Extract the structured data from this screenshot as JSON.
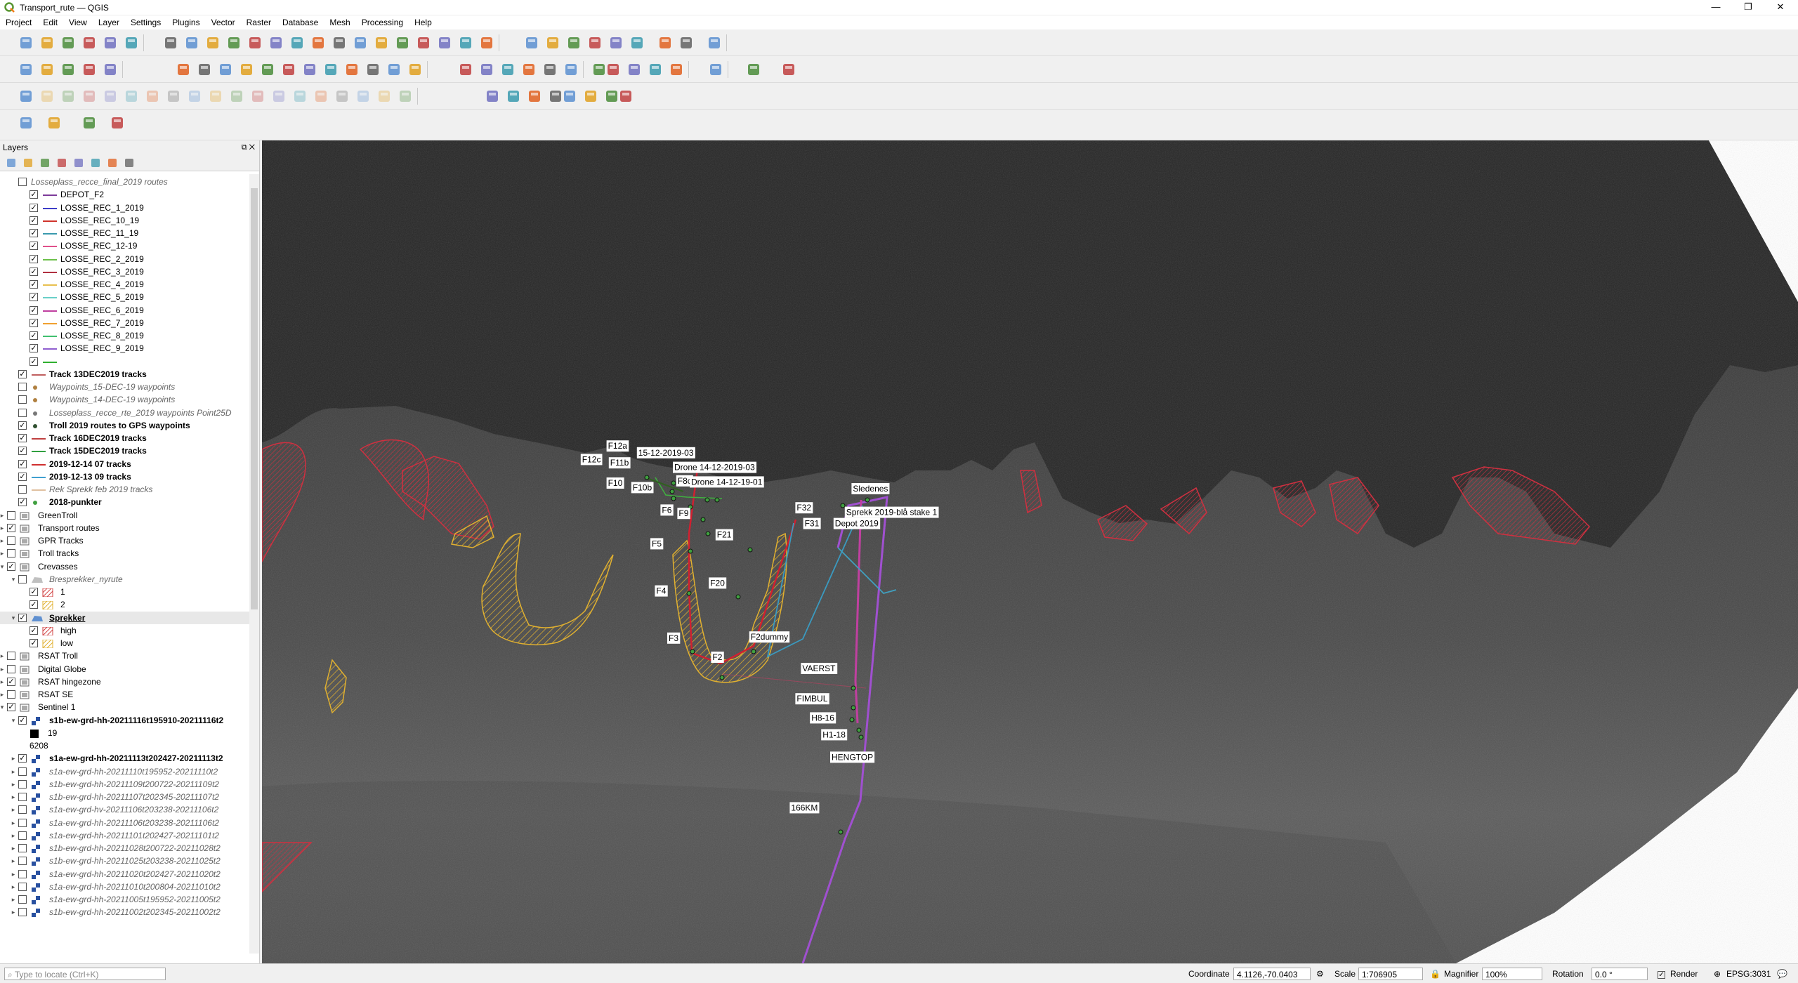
{
  "window": {
    "title": "Transport_rute — QGIS",
    "minimize": "—",
    "maximize": "❐",
    "close": "✕"
  },
  "menu": [
    "Project",
    "Edit",
    "View",
    "Layer",
    "Settings",
    "Plugins",
    "Vector",
    "Raster",
    "Database",
    "Mesh",
    "Processing",
    "Help"
  ],
  "layers_panel": {
    "title": "Layers",
    "items": [
      {
        "label": "Losseplass_recce_final_2019 routes",
        "style": "ital",
        "indent": 2,
        "check": false
      },
      {
        "label": "DEPOT_F2",
        "indent": 3,
        "check": true,
        "color": "#7d3b9a"
      },
      {
        "label": "LOSSE_REC_1_2019",
        "indent": 3,
        "check": true,
        "color": "#3d3dc8"
      },
      {
        "label": "LOSSE_REC_10_19",
        "indent": 3,
        "check": true,
        "color": "#d0342c"
      },
      {
        "label": "LOSSE_REC_11_19",
        "indent": 3,
        "check": true,
        "color": "#3a9aae"
      },
      {
        "label": "LOSSE_REC_12-19",
        "indent": 3,
        "check": true,
        "color": "#e0508a"
      },
      {
        "label": "LOSSE_REC_2_2019",
        "indent": 3,
        "check": true,
        "color": "#6cc04a"
      },
      {
        "label": "LOSSE_REC_3_2019",
        "indent": 3,
        "check": true,
        "color": "#b03040"
      },
      {
        "label": "LOSSE_REC_4_2019",
        "indent": 3,
        "check": true,
        "color": "#e8c050"
      },
      {
        "label": "LOSSE_REC_5_2019",
        "indent": 3,
        "check": true,
        "color": "#6ad0c8"
      },
      {
        "label": "LOSSE_REC_6_2019",
        "indent": 3,
        "check": true,
        "color": "#c040a0"
      },
      {
        "label": "LOSSE_REC_7_2019",
        "indent": 3,
        "check": true,
        "color": "#f0a030"
      },
      {
        "label": "LOSSE_REC_8_2019",
        "indent": 3,
        "check": true,
        "color": "#40c070"
      },
      {
        "label": "LOSSE_REC_9_2019",
        "indent": 3,
        "check": true,
        "color": "#9060d0"
      },
      {
        "label": "",
        "indent": 3,
        "check": true,
        "color": "#30b030"
      },
      {
        "label": "Track 13DEC2019 tracks",
        "style": "bold",
        "indent": 2,
        "check": true,
        "color": "#c06060"
      },
      {
        "label": "Waypoints_15-DEC-19 waypoints",
        "style": "ital",
        "indent": 2,
        "check": false,
        "dot": "#b08040"
      },
      {
        "label": "Waypoints_14-DEC-19 waypoints",
        "style": "ital",
        "indent": 2,
        "check": false,
        "dot": "#b08040"
      },
      {
        "label": "Losseplass_recce_rte_2019 waypoints Point25D",
        "style": "ital",
        "indent": 2,
        "check": false,
        "dot": "#777777"
      },
      {
        "label": "Troll 2019 routes to GPS waypoints",
        "style": "bold",
        "indent": 2,
        "check": true,
        "dot": "#305030"
      },
      {
        "label": "Track 16DEC2019 tracks",
        "style": "bold",
        "indent": 2,
        "check": true,
        "color": "#c04040"
      },
      {
        "label": "Track 15DEC2019 tracks",
        "style": "bold",
        "indent": 2,
        "check": true,
        "color": "#30a040"
      },
      {
        "label": "2019-12-14 07 tracks",
        "style": "bold",
        "indent": 2,
        "check": true,
        "color": "#d03030"
      },
      {
        "label": "2019-12-13 09 tracks",
        "style": "bold",
        "indent": 2,
        "check": true,
        "color": "#40a0d0"
      },
      {
        "label": "Rek Sprekk feb 2019 tracks",
        "style": "ital",
        "indent": 2,
        "check": false,
        "color": "#e0c0a0"
      },
      {
        "label": "2018-punkter",
        "style": "bold",
        "indent": 2,
        "check": true,
        "dot": "#40a040"
      },
      {
        "label": "GreenTroll",
        "indent": 1,
        "check": false,
        "group": true,
        "exp": "▸"
      },
      {
        "label": "Transport routes",
        "indent": 1,
        "check": true,
        "group": true,
        "exp": "▸"
      },
      {
        "label": "GPR Tracks",
        "indent": 1,
        "check": false,
        "group": true,
        "exp": "▸"
      },
      {
        "label": "Troll tracks",
        "indent": 1,
        "check": false,
        "group": true,
        "exp": "▸"
      },
      {
        "label": "Crevasses",
        "indent": 1,
        "check": true,
        "group": true,
        "exp": "▾"
      },
      {
        "label": "Bresprekker_nyrute",
        "style": "ital",
        "indent": 2,
        "check": false,
        "exp": "▾",
        "poly": "#c0c0c0"
      },
      {
        "label": "1",
        "indent": 3,
        "check": true,
        "hatch": "#d04040"
      },
      {
        "label": "2",
        "indent": 3,
        "check": true,
        "hatch": "#e0b030"
      },
      {
        "label": "Sprekker",
        "style": "bold-u",
        "indent": 2,
        "check": true,
        "exp": "▾",
        "poly": "#6090d0",
        "selected": true
      },
      {
        "label": "high",
        "indent": 3,
        "check": true,
        "hatch": "#d04040"
      },
      {
        "label": "low",
        "indent": 3,
        "check": true,
        "hatch": "#e0b030"
      },
      {
        "label": "RSAT Troll",
        "indent": 1,
        "check": false,
        "group": true,
        "exp": "▸"
      },
      {
        "label": "Digital Globe",
        "indent": 1,
        "check": false,
        "group": true,
        "exp": "▸"
      },
      {
        "label": "RSAT hingezone",
        "indent": 1,
        "check": true,
        "group": true,
        "exp": "▸"
      },
      {
        "label": "RSAT SE",
        "indent": 1,
        "check": false,
        "group": true,
        "exp": "▸"
      },
      {
        "label": "Sentinel 1",
        "indent": 1,
        "check": true,
        "group": true,
        "exp": "▾"
      },
      {
        "label": "s1b-ew-grd-hh-20211116t195910-20211116t2",
        "style": "bold",
        "indent": 2,
        "check": true,
        "exp": "▾",
        "raster": true
      },
      {
        "label": "19",
        "indent": 3,
        "swatch": "#000000"
      },
      {
        "label": "6208",
        "indent": 3
      },
      {
        "label": "s1a-ew-grd-hh-20211113t202427-20211113t2",
        "style": "bold",
        "indent": 2,
        "check": true,
        "exp": "▸",
        "raster": true
      },
      {
        "label": "s1a-ew-grd-hh-20211110t195952-20211110t2",
        "style": "ital",
        "indent": 2,
        "check": false,
        "exp": "▸",
        "raster": true
      },
      {
        "label": "s1b-ew-grd-hh-20211109t200722-20211109t2",
        "style": "ital",
        "indent": 2,
        "check": false,
        "exp": "▸",
        "raster": true
      },
      {
        "label": "s1b-ew-grd-hh-20211107t202345-20211107t2",
        "style": "ital",
        "indent": 2,
        "check": false,
        "exp": "▸",
        "raster": true
      },
      {
        "label": "s1a-ew-grd-hv-20211106t203238-20211106t2",
        "style": "ital",
        "indent": 2,
        "check": false,
        "exp": "▸",
        "raster": true
      },
      {
        "label": "s1a-ew-grd-hh-20211106t203238-20211106t2",
        "style": "ital",
        "indent": 2,
        "check": false,
        "exp": "▸",
        "raster": true
      },
      {
        "label": "s1a-ew-grd-hh-20211101t202427-20211101t2",
        "style": "ital",
        "indent": 2,
        "check": false,
        "exp": "▸",
        "raster": true
      },
      {
        "label": "s1b-ew-grd-hh-20211028t200722-20211028t2",
        "style": "ital",
        "indent": 2,
        "check": false,
        "exp": "▸",
        "raster": true
      },
      {
        "label": "s1b-ew-grd-hh-20211025t203238-20211025t2",
        "style": "ital",
        "indent": 2,
        "check": false,
        "exp": "▸",
        "raster": true
      },
      {
        "label": "s1a-ew-grd-hh-20211020t202427-20211020t2",
        "style": "ital",
        "indent": 2,
        "check": false,
        "exp": "▸",
        "raster": true
      },
      {
        "label": "s1a-ew-grd-hh-20211010t200804-20211010t2",
        "style": "ital",
        "indent": 2,
        "check": false,
        "exp": "▸",
        "raster": true
      },
      {
        "label": "s1a-ew-grd-hh-20211005t195952-20211005t2",
        "style": "ital",
        "indent": 2,
        "check": false,
        "exp": "▸",
        "raster": true
      },
      {
        "label": "s1b-ew-grd-hh-20211002t202345-20211002t2",
        "style": "ital",
        "indent": 2,
        "check": false,
        "exp": "▸",
        "raster": true
      }
    ]
  },
  "map_labels": [
    "F12c",
    "F12a",
    "F11b",
    "15-12-2019-03",
    "Drone 14-12-2019-03",
    "F8c",
    "Drone 14-12-19-01",
    "F10",
    "F10b",
    "F6",
    "F9",
    "F32",
    "Sledenes",
    "F31",
    "Sprekk 2019-blå stake 1",
    "Depot 2019",
    "F21",
    "F5",
    "F20",
    "F4",
    "F3",
    "F2dummy",
    "F2",
    "VAERST",
    "FIMBUL",
    "H8-16",
    "H1-18",
    "HENGTOP",
    "166KM"
  ],
  "status": {
    "locate_placeholder": "Type to locate (Ctrl+K)",
    "coordinate_label": "Coordinate",
    "coordinate_value": "4.1126,-70.0403",
    "scale_label": "Scale",
    "scale_value": "1:706905",
    "magnifier_label": "Magnifier",
    "magnifier_value": "100%",
    "rotation_label": "Rotation",
    "rotation_value": "0.0 °",
    "render_label": "Render",
    "crs_label": "EPSG:3031"
  }
}
